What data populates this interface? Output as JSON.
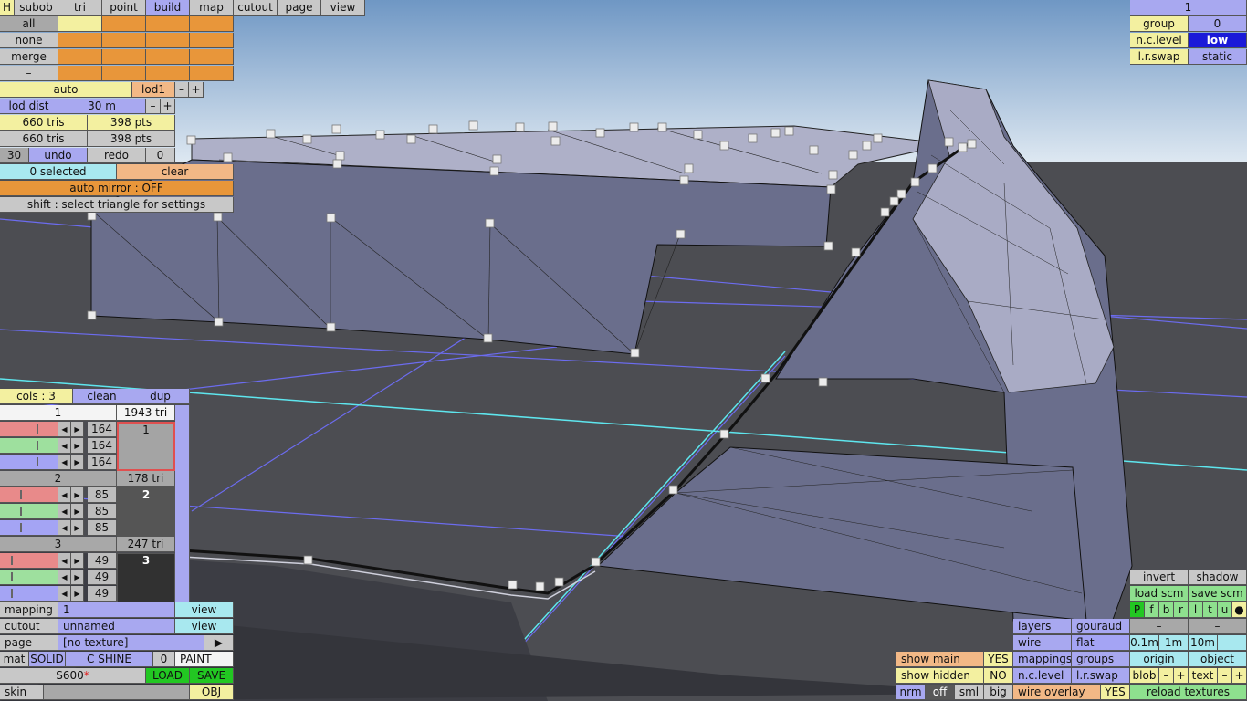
{
  "colors": {
    "sky": "#bcd4e6",
    "floor": "#4c4d52",
    "mesh": "#6a6e8c",
    "meshLight": "#aeb0c8",
    "grid": "#6c6cf0",
    "cyan": "#5ee6ee",
    "accent_orange": "#e8963a",
    "accent_yellow": "#f3f0a0"
  },
  "top_tabs": [
    "H",
    "subob",
    "tri",
    "point",
    "build",
    "map",
    "cutout",
    "page",
    "view"
  ],
  "select_rows": [
    "all",
    "none",
    "merge",
    "–"
  ],
  "lod": {
    "auto": "auto",
    "level": "lod1",
    "minus": "–",
    "plus": "+",
    "dist_label": "lod dist",
    "dist_value": "30 m",
    "dist_minus": "–",
    "dist_plus": "+"
  },
  "stats": {
    "tris1": "660 tris",
    "pts1": "398 pts",
    "tris2": "660 tris",
    "pts2": "398 pts"
  },
  "history": {
    "count": "30",
    "undo": "undo",
    "redo": "redo",
    "redo_count": "0"
  },
  "selection": {
    "selected": "0 selected",
    "clear": "clear",
    "auto_mirror": "auto mirror : OFF",
    "hint": "shift : select triangle for settings"
  },
  "colors_panel": {
    "cols": "cols : 3",
    "clean": "clean",
    "dup": "dup",
    "entries": [
      {
        "index": "1",
        "tris": "1943 tri",
        "r": "164",
        "g": "164",
        "b": "164",
        "swatch": "1"
      },
      {
        "index": "2",
        "tris": "178 tri",
        "r": "85",
        "g": "85",
        "b": "85",
        "swatch": "2"
      },
      {
        "index": "3",
        "tris": "247 tri",
        "r": "49",
        "g": "49",
        "b": "49",
        "swatch": "3"
      }
    ]
  },
  "bottom_left": {
    "mapping_label": "mapping",
    "mapping_value": "1",
    "mapping_view": "view",
    "cutout_label": "cutout",
    "cutout_value": "unnamed",
    "cutout_view": "view",
    "page_label": "page",
    "page_value": "[no texture]",
    "page_arrow": "▶",
    "mat": "mat",
    "solid": "SOLID",
    "cshine": "C SHINE",
    "shine_val": "0",
    "paint": "PAINT",
    "model": "S600",
    "model_mark": "*",
    "load": "LOAD",
    "save": "SAVE",
    "skin": "skin",
    "obj": "OBJ"
  },
  "top_right": {
    "number": "1",
    "group_label": "group",
    "group_value": "0",
    "nc_label": "n.c.level",
    "nc_value": "low",
    "lr_label": "l.r.swap",
    "lr_value": "static"
  },
  "bottom_right": {
    "invert": "invert",
    "shadow": "shadow",
    "load_scm": "load scm",
    "save_scm": "save scm",
    "flags": [
      "P",
      "f",
      "b",
      "r",
      "l",
      "t",
      "u",
      "●"
    ],
    "dash1": "–",
    "dash2": "–",
    "d01": "0.1m",
    "d1": "1m",
    "d10": "10m",
    "dminus": "–",
    "layers": "layers",
    "gouraud": "gouraud",
    "wire": "wire",
    "flat": "flat",
    "mappings": "mappings",
    "groups": "groups",
    "nclevel": "n.c.level",
    "lrswap": "l.r.swap",
    "wire_overlay": "wire overlay",
    "wire_overlay_val": "YES",
    "origin": "origin",
    "object": "object",
    "blob": "blob",
    "text": "text",
    "minus": "–",
    "plus": "+",
    "reload": "reload textures",
    "show_main": "show main",
    "show_main_val": "YES",
    "show_hidden": "show hidden",
    "show_hidden_val": "NO",
    "nrm": "nrm",
    "off": "off",
    "sml": "sml",
    "big": "big"
  }
}
